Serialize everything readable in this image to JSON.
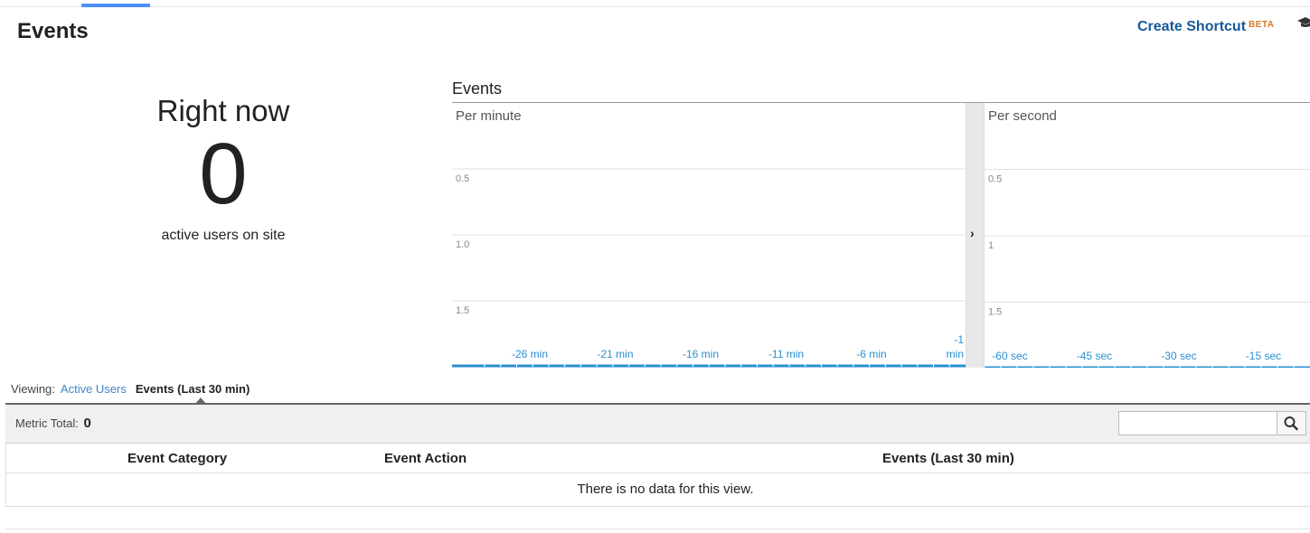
{
  "header": {
    "title": "Events",
    "shortcut_label": "Create Shortcut",
    "shortcut_badge": "BETA"
  },
  "right_now": {
    "label": "Right now",
    "count": "0",
    "sub": "active users on site"
  },
  "events_chart": {
    "title": "Events",
    "per_minute": {
      "title": "Per minute",
      "y_ticks": [
        "1.5",
        "1.0",
        "0.5"
      ],
      "x_ticks": [
        "-26 min",
        "-21 min",
        "-16 min",
        "-11 min",
        "-6 min"
      ],
      "x_last_tick_line1": "-1",
      "x_last_tick_line2": "min"
    },
    "per_second": {
      "title": "Per second",
      "y_ticks": [
        "1.5",
        "1",
        "0.5"
      ],
      "x_ticks": [
        "-60 sec",
        "-45 sec",
        "-30 sec",
        "-15 sec"
      ]
    },
    "expand_arrow": "›"
  },
  "chart_data": [
    {
      "type": "bar",
      "title": "Per minute",
      "categories": [
        "-26 min",
        "-21 min",
        "-16 min",
        "-11 min",
        "-6 min",
        "-1 min"
      ],
      "values": [
        0,
        0,
        0,
        0,
        0,
        0
      ],
      "y_ticks": [
        0.5,
        1.0,
        1.5
      ],
      "ylim": [
        0,
        2
      ],
      "grid": true
    },
    {
      "type": "bar",
      "title": "Per second",
      "categories": [
        "-60 sec",
        "-45 sec",
        "-30 sec",
        "-15 sec"
      ],
      "values": [
        0,
        0,
        0,
        0
      ],
      "y_ticks": [
        0.5,
        1,
        1.5
      ],
      "ylim": [
        0,
        2
      ],
      "grid": true
    }
  ],
  "viewing": {
    "label": "Viewing:",
    "link": "Active Users",
    "active": "Events (Last 30 min)"
  },
  "metric": {
    "label": "Metric Total:",
    "value": "0",
    "search_placeholder": ""
  },
  "table": {
    "columns": [
      "Event Category",
      "Event Action",
      "Events (Last 30 min)"
    ],
    "empty_message": "There is no data for this view."
  },
  "colors": {
    "accent": "#4d90fe",
    "link": "#3d86c6",
    "shortcut": "#15589a",
    "beta": "#dd7722",
    "axis": "#2a8fd0"
  }
}
